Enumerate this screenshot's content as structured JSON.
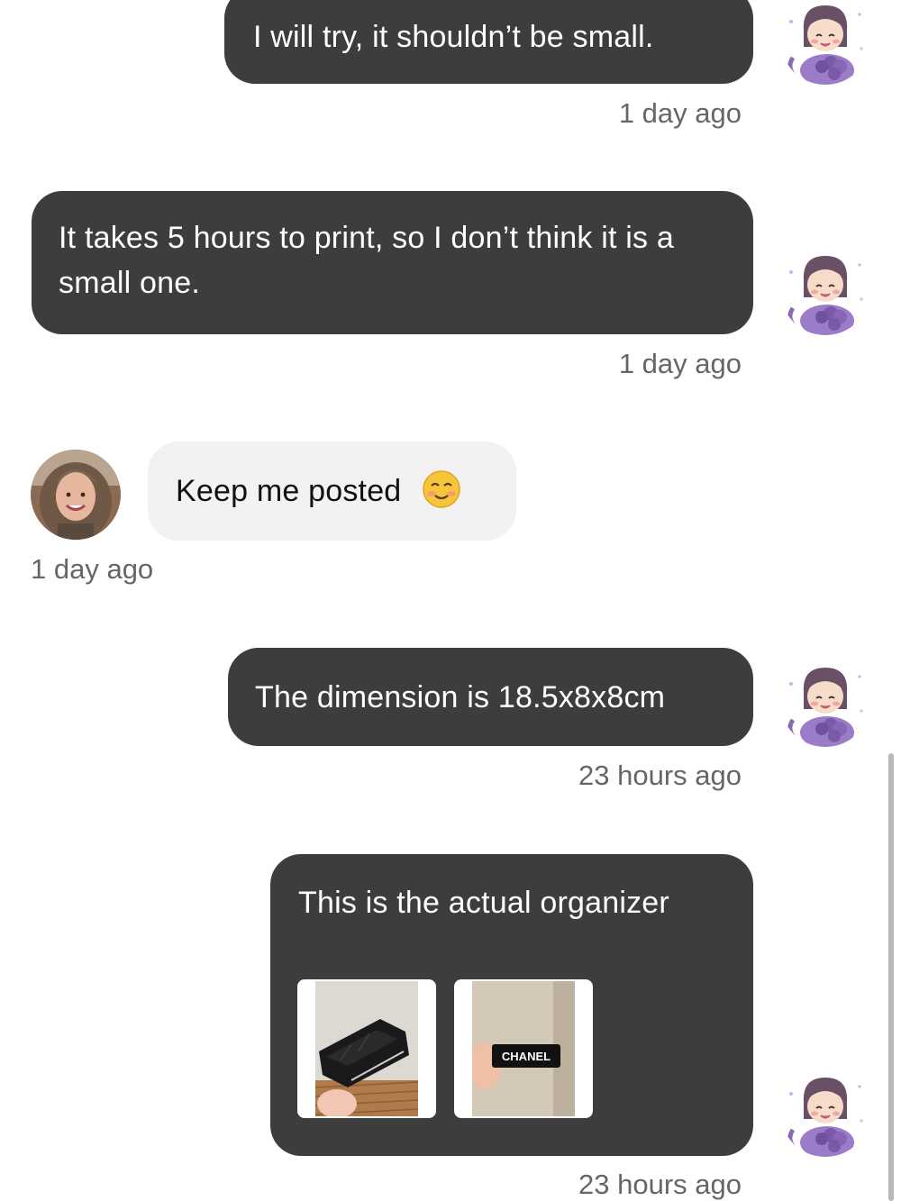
{
  "messages": [
    {
      "direction": "outgoing",
      "text": "I will try, it shouldn’t be small.",
      "time": "1 day ago"
    },
    {
      "direction": "outgoing",
      "text": "It takes 5 hours to print, so I don’t think it is a small one.",
      "time": "1 day ago"
    },
    {
      "direction": "incoming",
      "text": "Keep me posted",
      "emoji": "smiling-face-with-smiling-eyes",
      "time": "1 day ago"
    },
    {
      "direction": "outgoing",
      "text": "The dimension is 18.5x8x8cm",
      "time": "23 hours ago"
    },
    {
      "direction": "outgoing",
      "text": "This is the actual organizer",
      "time": "23 hours ago",
      "attachments": [
        {
          "kind": "photo",
          "subject": "black organizer box"
        },
        {
          "kind": "photo",
          "subject": "organizer side label",
          "label_text": "CHANEL"
        }
      ]
    }
  ],
  "colors": {
    "outgoing_bubble": "#3d3d3d",
    "incoming_bubble": "#f2f2f2",
    "timestamp": "#666666"
  },
  "icons": {
    "sender_avatar": "cartoon-girl-with-lavender-avatar",
    "recipient_avatar": "woman-photo-avatar",
    "emoji": "smiling-face-with-smiling-eyes"
  }
}
